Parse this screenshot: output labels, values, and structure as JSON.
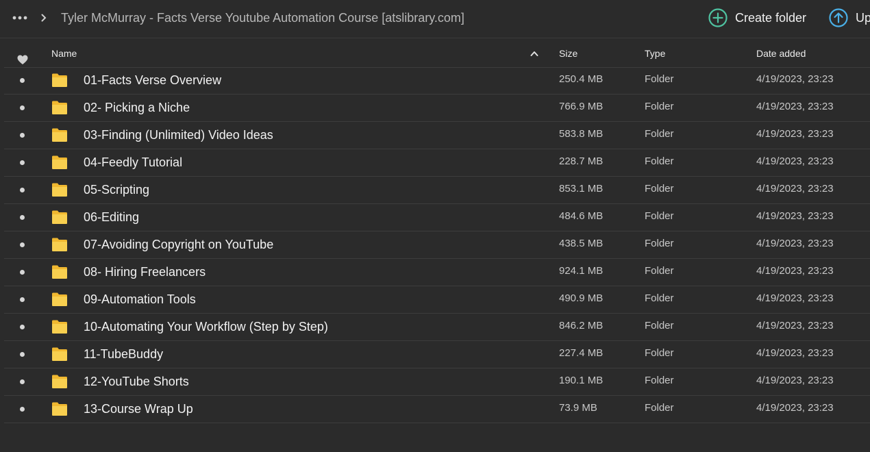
{
  "topbar": {
    "more_icon": "ellipsis-icon",
    "separator_icon": "chevron-right-icon",
    "breadcrumb": "Tyler McMurray - Facts Verse Youtube Automation Course [atslibrary.com]",
    "create_folder_label": "Create folder",
    "upload_label": "Up",
    "accent_color": "#4fc3a1",
    "upload_color": "#4ab0e8"
  },
  "header": {
    "favorite_icon": "heart-icon",
    "name": "Name",
    "sort_icon": "sort-ascending-icon",
    "size": "Size",
    "type": "Type",
    "date_added": "Date added"
  },
  "folder_color": "#f5c542",
  "rows": [
    {
      "name": "01-Facts Verse Overview",
      "size": "250.4 MB",
      "type": "Folder",
      "date": "4/19/2023, 23:23"
    },
    {
      "name": "02- Picking a Niche",
      "size": "766.9 MB",
      "type": "Folder",
      "date": "4/19/2023, 23:23"
    },
    {
      "name": "03-Finding (Unlimited) Video Ideas",
      "size": "583.8 MB",
      "type": "Folder",
      "date": "4/19/2023, 23:23"
    },
    {
      "name": "04-Feedly Tutorial",
      "size": "228.7 MB",
      "type": "Folder",
      "date": "4/19/2023, 23:23"
    },
    {
      "name": "05-Scripting",
      "size": "853.1 MB",
      "type": "Folder",
      "date": "4/19/2023, 23:23"
    },
    {
      "name": "06-Editing",
      "size": "484.6 MB",
      "type": "Folder",
      "date": "4/19/2023, 23:23"
    },
    {
      "name": "07-Avoiding Copyright on YouTube",
      "size": "438.5 MB",
      "type": "Folder",
      "date": "4/19/2023, 23:23"
    },
    {
      "name": "08- Hiring Freelancers",
      "size": "924.1 MB",
      "type": "Folder",
      "date": "4/19/2023, 23:23"
    },
    {
      "name": "09-Automation Tools",
      "size": "490.9 MB",
      "type": "Folder",
      "date": "4/19/2023, 23:23"
    },
    {
      "name": "10-Automating Your Workflow (Step by Step)",
      "size": "846.2 MB",
      "type": "Folder",
      "date": "4/19/2023, 23:23"
    },
    {
      "name": "11-TubeBuddy",
      "size": "227.4 MB",
      "type": "Folder",
      "date": "4/19/2023, 23:23"
    },
    {
      "name": "12-YouTube Shorts",
      "size": "190.1 MB",
      "type": "Folder",
      "date": "4/19/2023, 23:23"
    },
    {
      "name": "13-Course Wrap Up",
      "size": "73.9 MB",
      "type": "Folder",
      "date": "4/19/2023, 23:23"
    }
  ]
}
